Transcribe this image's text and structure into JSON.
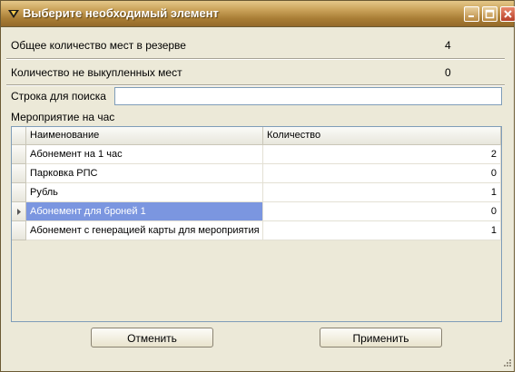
{
  "window": {
    "title": "Выберите необходимый элемент",
    "colors": {
      "titlebar": "#b48a42",
      "face": "#ece9d8",
      "selected_row": "#7b96e0"
    }
  },
  "summary": {
    "reserved_label": "Общее количество мест в резерве",
    "reserved_value": "4",
    "unpaid_label": "Количество не выкупленных мест",
    "unpaid_value": "0"
  },
  "search": {
    "label": "Строка для поиска",
    "value": ""
  },
  "event": {
    "label": "Мероприятие на час"
  },
  "table": {
    "columns": [
      "Наименование",
      "Количество"
    ],
    "rows": [
      {
        "name": "Абонемент на 1 час",
        "qty": "2"
      },
      {
        "name": "Парковка РПС",
        "qty": "0"
      },
      {
        "name": "Рубль",
        "qty": "1"
      },
      {
        "name": "Абонемент для броней 1",
        "qty": "0"
      },
      {
        "name": "Абонемент с генерацией карты для мероприятия",
        "qty": "1"
      }
    ],
    "selected_row": 3
  },
  "buttons": {
    "cancel": "Отменить",
    "apply": "Применить"
  },
  "icons": [
    "app-icon",
    "minimize-icon",
    "maximize-icon",
    "close-icon",
    "row-pointer-icon",
    "resize-grip-icon"
  ]
}
